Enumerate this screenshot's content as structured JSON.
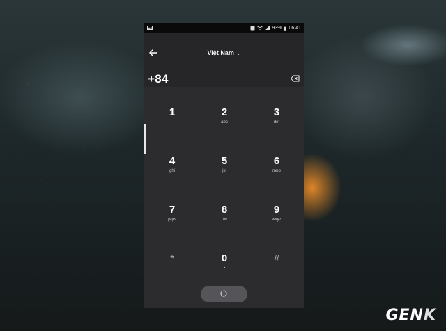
{
  "status_bar": {
    "battery": "93%",
    "time": "06:41",
    "icons": [
      "image-icon",
      "alarm-icon",
      "wifi-icon",
      "signal-icon",
      "battery-icon"
    ]
  },
  "header": {
    "country": "Việt Nam",
    "number": "+84"
  },
  "keypad": {
    "keys": [
      {
        "digit": "1",
        "letters": ""
      },
      {
        "digit": "2",
        "letters": "abc"
      },
      {
        "digit": "3",
        "letters": "def"
      },
      {
        "digit": "4",
        "letters": "ghi"
      },
      {
        "digit": "5",
        "letters": "jkl"
      },
      {
        "digit": "6",
        "letters": "mno"
      },
      {
        "digit": "7",
        "letters": "pqrs"
      },
      {
        "digit": "8",
        "letters": "tuv"
      },
      {
        "digit": "9",
        "letters": "wxyz"
      },
      {
        "digit": "*",
        "letters": ""
      },
      {
        "digit": "0",
        "letters": "•"
      },
      {
        "digit": "#",
        "letters": ""
      }
    ]
  },
  "watermark": {
    "brand": "GEN",
    "brand_k": "K"
  },
  "colors": {
    "screen_bg": "#2c2c2f",
    "header_bg": "#262628",
    "call_button": "#545459",
    "text": "#ffffff"
  }
}
